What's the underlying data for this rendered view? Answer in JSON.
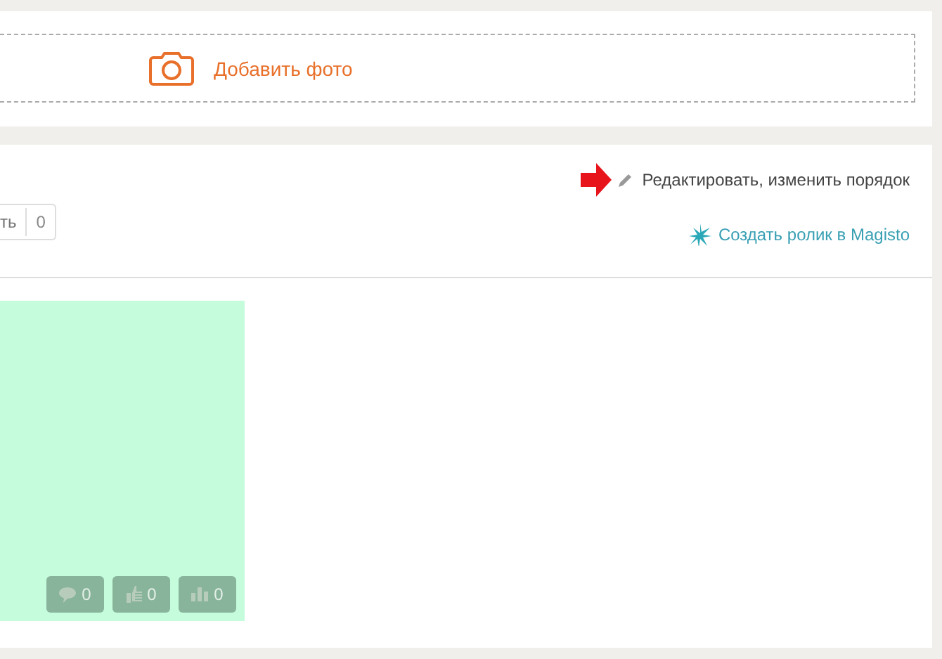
{
  "upload": {
    "label": "Добавить фото"
  },
  "album": {
    "edit_link": "Редактировать, изменить порядок",
    "counter_button": {
      "label": "ть",
      "count": "0"
    },
    "magisto_link": "Создать ролик в Magisto"
  },
  "photos": [
    {
      "stats": [
        {
          "kind": "comments",
          "count": "0"
        },
        {
          "kind": "likes",
          "count": "0"
        },
        {
          "kind": "views",
          "count": "0"
        }
      ]
    }
  ]
}
